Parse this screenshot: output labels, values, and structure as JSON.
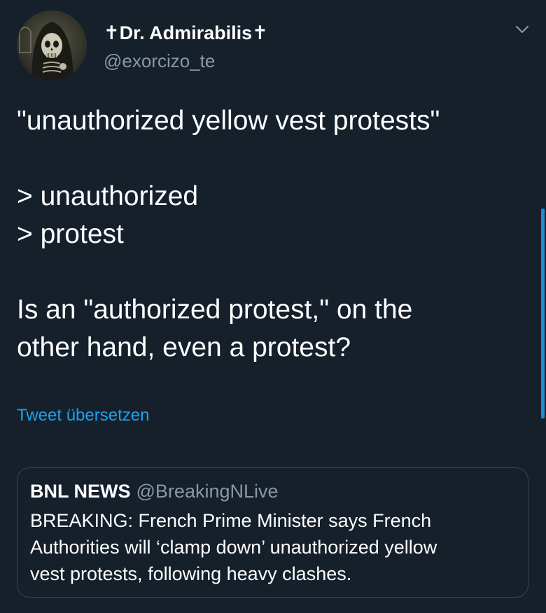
{
  "tweet": {
    "author": {
      "display_name": "✝Dr. Admirabilis✝",
      "handle": "@exorcizo_te",
      "avatar_icon": "skeleton-avatar-icon"
    },
    "menu_icon": "chevron-down-icon",
    "text_lines": [
      "\"unauthorized yellow vest protests\"",
      "",
      "> unauthorized",
      "> protest",
      "",
      "Is an \"authorized protest,\" on the",
      "other hand, even a protest?"
    ],
    "translate_label": "Tweet übersetzen"
  },
  "quoted_tweet": {
    "name": "BNL NEWS",
    "handle": "@BreakingNLive",
    "text_lines": [
      "BREAKING: French Prime Minister says French",
      "Authorities will ‘clamp down’ unauthorized yellow",
      "vest protests, following heavy clashes."
    ]
  },
  "colors": {
    "background": "#15202b",
    "text_primary": "#ffffff",
    "text_secondary": "#8899a6",
    "link": "#1da1f2",
    "border": "#38444d"
  }
}
